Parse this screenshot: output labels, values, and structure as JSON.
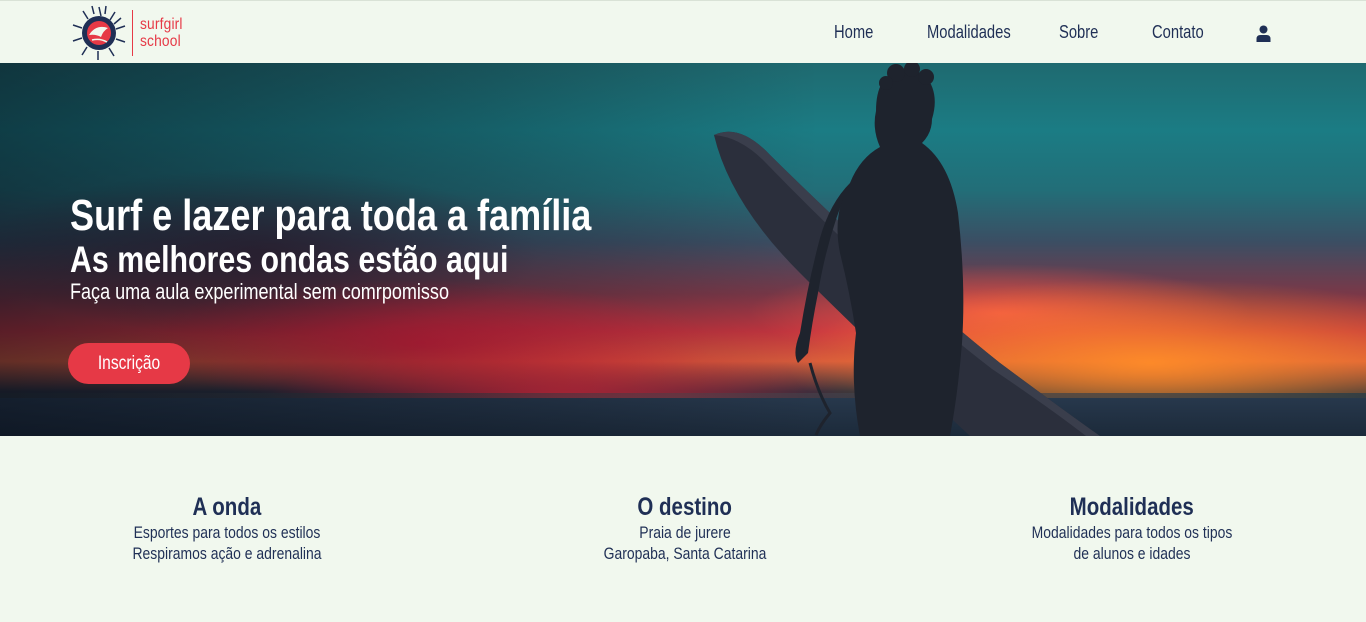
{
  "brand": {
    "name_line1": "surfgirl",
    "name_line2": "school",
    "color": "#e63946"
  },
  "nav": {
    "items": [
      {
        "label": "Home"
      },
      {
        "label": "Modalidades"
      },
      {
        "label": "Sobre"
      },
      {
        "label": "Contato"
      }
    ],
    "user_icon": "user-icon"
  },
  "hero": {
    "title": "Surf e lazer para toda a família",
    "subtitle": "As melhores ondas estão aqui",
    "tagline": "Faça uma aula experimental sem comrpomisso",
    "cta_label": "Inscrição"
  },
  "features": [
    {
      "title": "A onda",
      "line1": "Esportes para todos os estilos",
      "line2": "Respiramos ação e adrenalina"
    },
    {
      "title": "O destino",
      "line1": "Praia de jurere",
      "line2": "Garopaba, Santa Catarina"
    },
    {
      "title": "Modalidades",
      "line1": "Modalidades para todos os tipos",
      "line2": "de alunos e idades"
    }
  ],
  "colors": {
    "background": "#f1f8ee",
    "text": "#1f2f55",
    "accent": "#e63946"
  }
}
